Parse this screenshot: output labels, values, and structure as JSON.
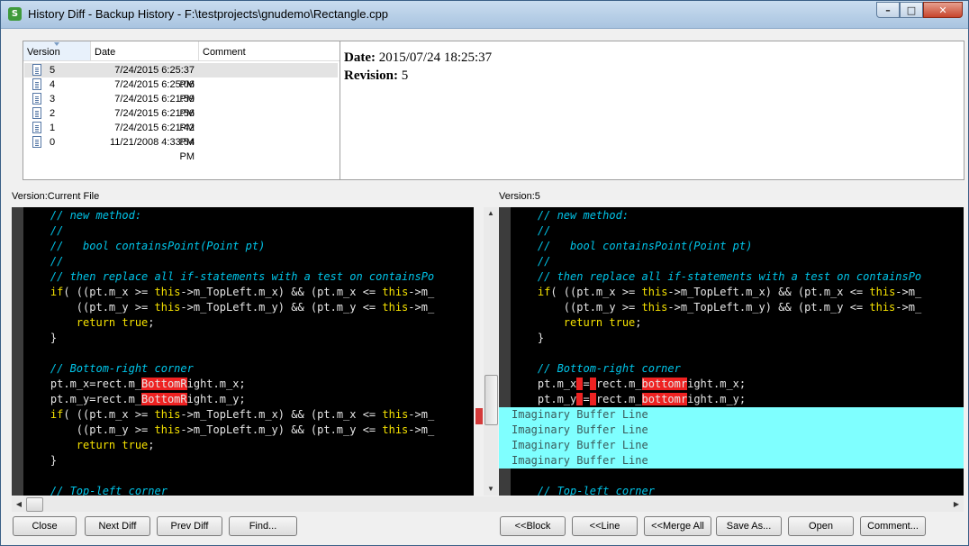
{
  "window": {
    "title": "History Diff - Backup History - F:\\testprojects\\gnudemo\\Rectangle.cpp",
    "app_icon_glyph": "S",
    "controls": {
      "minimize": "–",
      "maximize": "□",
      "close": "✕"
    }
  },
  "versions": {
    "headers": {
      "version": "Version",
      "date": "Date",
      "comment": "Comment"
    },
    "rows": [
      {
        "version": "5",
        "date": "7/24/2015 6:25:37 PM",
        "comment": "",
        "selected": true
      },
      {
        "version": "4",
        "date": "7/24/2015 6:25:06 PM",
        "comment": ""
      },
      {
        "version": "3",
        "date": "7/24/2015 6:21:59 PM",
        "comment": ""
      },
      {
        "version": "2",
        "date": "7/24/2015 6:21:56 PM",
        "comment": ""
      },
      {
        "version": "1",
        "date": "7/24/2015 6:21:42 PM",
        "comment": ""
      },
      {
        "version": "0",
        "date": "11/21/2008 4:33:54 PM",
        "comment": ""
      }
    ]
  },
  "info": {
    "date_label": "Date:",
    "date_value": "2015/07/24 18:25:37",
    "revision_label": "Revision:",
    "revision_value": "5"
  },
  "left_pane": {
    "label": "Version:Current File",
    "lines": [
      [
        [
          "cm",
          "    // new method:"
        ]
      ],
      [
        [
          "cm",
          "    //"
        ]
      ],
      [
        [
          "cm",
          "    //   bool containsPoint(Point pt)"
        ]
      ],
      [
        [
          "cm",
          "    //"
        ]
      ],
      [
        [
          "cm",
          "    // then replace all if-statements with a test on containsPo"
        ]
      ],
      [
        [
          "",
          "    "
        ],
        [
          "kw",
          "if"
        ],
        [
          "",
          "( ((pt.m_x >= "
        ],
        [
          "kw",
          "this"
        ],
        [
          "",
          "->m_TopLeft.m_x) && (pt.m_x <= "
        ],
        [
          "kw",
          "this"
        ],
        [
          "",
          "->m_"
        ]
      ],
      [
        [
          "",
          "        ((pt.m_y >= "
        ],
        [
          "kw",
          "this"
        ],
        [
          "",
          "->m_TopLeft.m_y) && (pt.m_y <= "
        ],
        [
          "kw",
          "this"
        ],
        [
          "",
          "->m_"
        ]
      ],
      [
        [
          "",
          "        "
        ],
        [
          "kw",
          "return true"
        ],
        [
          "",
          ";"
        ]
      ],
      [
        [
          "",
          "    }"
        ]
      ],
      [
        [
          "",
          ""
        ]
      ],
      [
        [
          "cm",
          "    // Bottom-right corner"
        ]
      ],
      [
        [
          "",
          "    pt.m_x=rect.m_"
        ],
        [
          "hl",
          "BottomR"
        ],
        [
          "",
          "ight.m_x;"
        ]
      ],
      [
        [
          "",
          "    pt.m_y=rect.m_"
        ],
        [
          "hl",
          "BottomR"
        ],
        [
          "",
          "ight.m_y;"
        ]
      ],
      [
        [
          "",
          "    "
        ],
        [
          "kw",
          "if"
        ],
        [
          "",
          "( ((pt.m_x >= "
        ],
        [
          "kw",
          "this"
        ],
        [
          "",
          "->m_TopLeft.m_x) && (pt.m_x <= "
        ],
        [
          "kw",
          "this"
        ],
        [
          "",
          "->m_"
        ]
      ],
      [
        [
          "",
          "        ((pt.m_y >= "
        ],
        [
          "kw",
          "this"
        ],
        [
          "",
          "->m_TopLeft.m_y) && (pt.m_y <= "
        ],
        [
          "kw",
          "this"
        ],
        [
          "",
          "->m_"
        ]
      ],
      [
        [
          "",
          "        "
        ],
        [
          "kw",
          "return true"
        ],
        [
          "",
          ";"
        ]
      ],
      [
        [
          "",
          "    }"
        ]
      ],
      [
        [
          "",
          ""
        ]
      ],
      [
        [
          "cm",
          "    // Top-left corner"
        ]
      ]
    ]
  },
  "right_pane": {
    "label": "Version:5",
    "lines": [
      [
        [
          "cm",
          "    // new method:"
        ]
      ],
      [
        [
          "cm",
          "    //"
        ]
      ],
      [
        [
          "cm",
          "    //   bool containsPoint(Point pt)"
        ]
      ],
      [
        [
          "cm",
          "    //"
        ]
      ],
      [
        [
          "cm",
          "    // then replace all if-statements with a test on containsPo"
        ]
      ],
      [
        [
          "",
          "    "
        ],
        [
          "kw",
          "if"
        ],
        [
          "",
          "( ((pt.m_x >= "
        ],
        [
          "kw",
          "this"
        ],
        [
          "",
          "->m_TopLeft.m_x) && (pt.m_x <= "
        ],
        [
          "kw",
          "this"
        ],
        [
          "",
          "->m_"
        ]
      ],
      [
        [
          "",
          "        ((pt.m_y >= "
        ],
        [
          "kw",
          "this"
        ],
        [
          "",
          "->m_TopLeft.m_y) && (pt.m_y <= "
        ],
        [
          "kw",
          "this"
        ],
        [
          "",
          "->m_"
        ]
      ],
      [
        [
          "",
          "        "
        ],
        [
          "kw",
          "return true"
        ],
        [
          "",
          ";"
        ]
      ],
      [
        [
          "",
          "    }"
        ]
      ],
      [
        [
          "",
          ""
        ]
      ],
      [
        [
          "cm",
          "    // Bottom-right corner"
        ]
      ],
      [
        [
          "",
          "    pt.m_x"
        ],
        [
          "hl",
          " "
        ],
        [
          "",
          "="
        ],
        [
          "hl",
          " "
        ],
        [
          "",
          "rect.m_"
        ],
        [
          "hl",
          "bottomr"
        ],
        [
          "",
          "ight.m_x;"
        ]
      ],
      [
        [
          "",
          "    pt.m_y"
        ],
        [
          "hl",
          " "
        ],
        [
          "",
          "="
        ],
        [
          "hl",
          " "
        ],
        [
          "",
          "rect.m_"
        ],
        [
          "hl",
          "bottomr"
        ],
        [
          "",
          "ight.m_y;"
        ]
      ],
      [
        [
          "buf",
          "Imaginary Buffer Line"
        ]
      ],
      [
        [
          "buf",
          "Imaginary Buffer Line"
        ]
      ],
      [
        [
          "buf",
          "Imaginary Buffer Line"
        ]
      ],
      [
        [
          "buf",
          "Imaginary Buffer Line"
        ]
      ],
      [
        [
          "",
          ""
        ]
      ],
      [
        [
          "cm",
          "    // Top-left corner"
        ]
      ]
    ]
  },
  "colors": {
    "code_bg": "#000000",
    "comment": "#00c4e8",
    "keyword": "#f5e100",
    "diff_highlight": "#ee2222",
    "buffer_line": "#7fffff"
  },
  "buttons": {
    "close": "Close",
    "next_diff": "Next Diff",
    "prev_diff": "Prev Diff",
    "find": "Find...",
    "block": "<<Block",
    "line": "<<Line",
    "merge_all": "<<Merge All",
    "save_as": "Save As...",
    "open": "Open",
    "comment": "Comment..."
  },
  "icons": {
    "scroll_up": "▲",
    "scroll_down": "▼",
    "scroll_left": "◀",
    "scroll_right": "▶"
  }
}
